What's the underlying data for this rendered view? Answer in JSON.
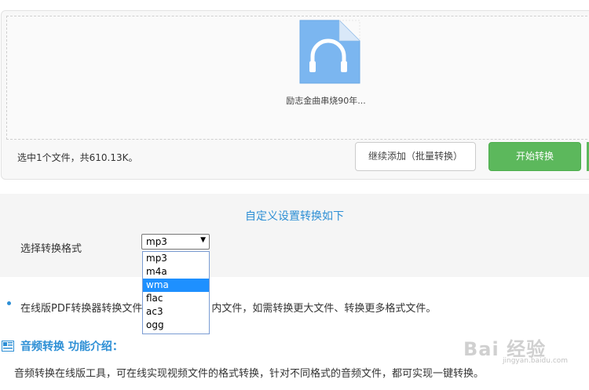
{
  "upload": {
    "file_name": "励志金曲串烧90年...",
    "status": "选中1个文件，共610.13K。",
    "add_button": "继续添加（批量转换）",
    "start_button": "开始转换"
  },
  "settings": {
    "title": "自定义设置转换如下",
    "format_label": "选择转换格式",
    "selected_format": "mp3",
    "options": [
      "mp3",
      "m4a",
      "wma",
      "flac",
      "ac3",
      "ogg"
    ],
    "highlighted_option": "wma"
  },
  "info": {
    "line_start": "在线版PDF转换器转换文件",
    "line_end": "内文件，如需转换更大文件、转换更多格式文件。"
  },
  "intro": {
    "heading": "音频转换 功能介绍：",
    "body": "音频转换在线版工具，可在线实现视频文件的格式转换，针对不同格式的音频文件，都可实现一键转换。"
  },
  "watermark": {
    "text": "Bai 经验",
    "sub": "jingyan.baidu.com"
  },
  "colors": {
    "accent": "#2d8fd5",
    "start_button": "#5cb85c",
    "file_icon": "#7bb6f0",
    "highlight": "#1e90ff"
  }
}
